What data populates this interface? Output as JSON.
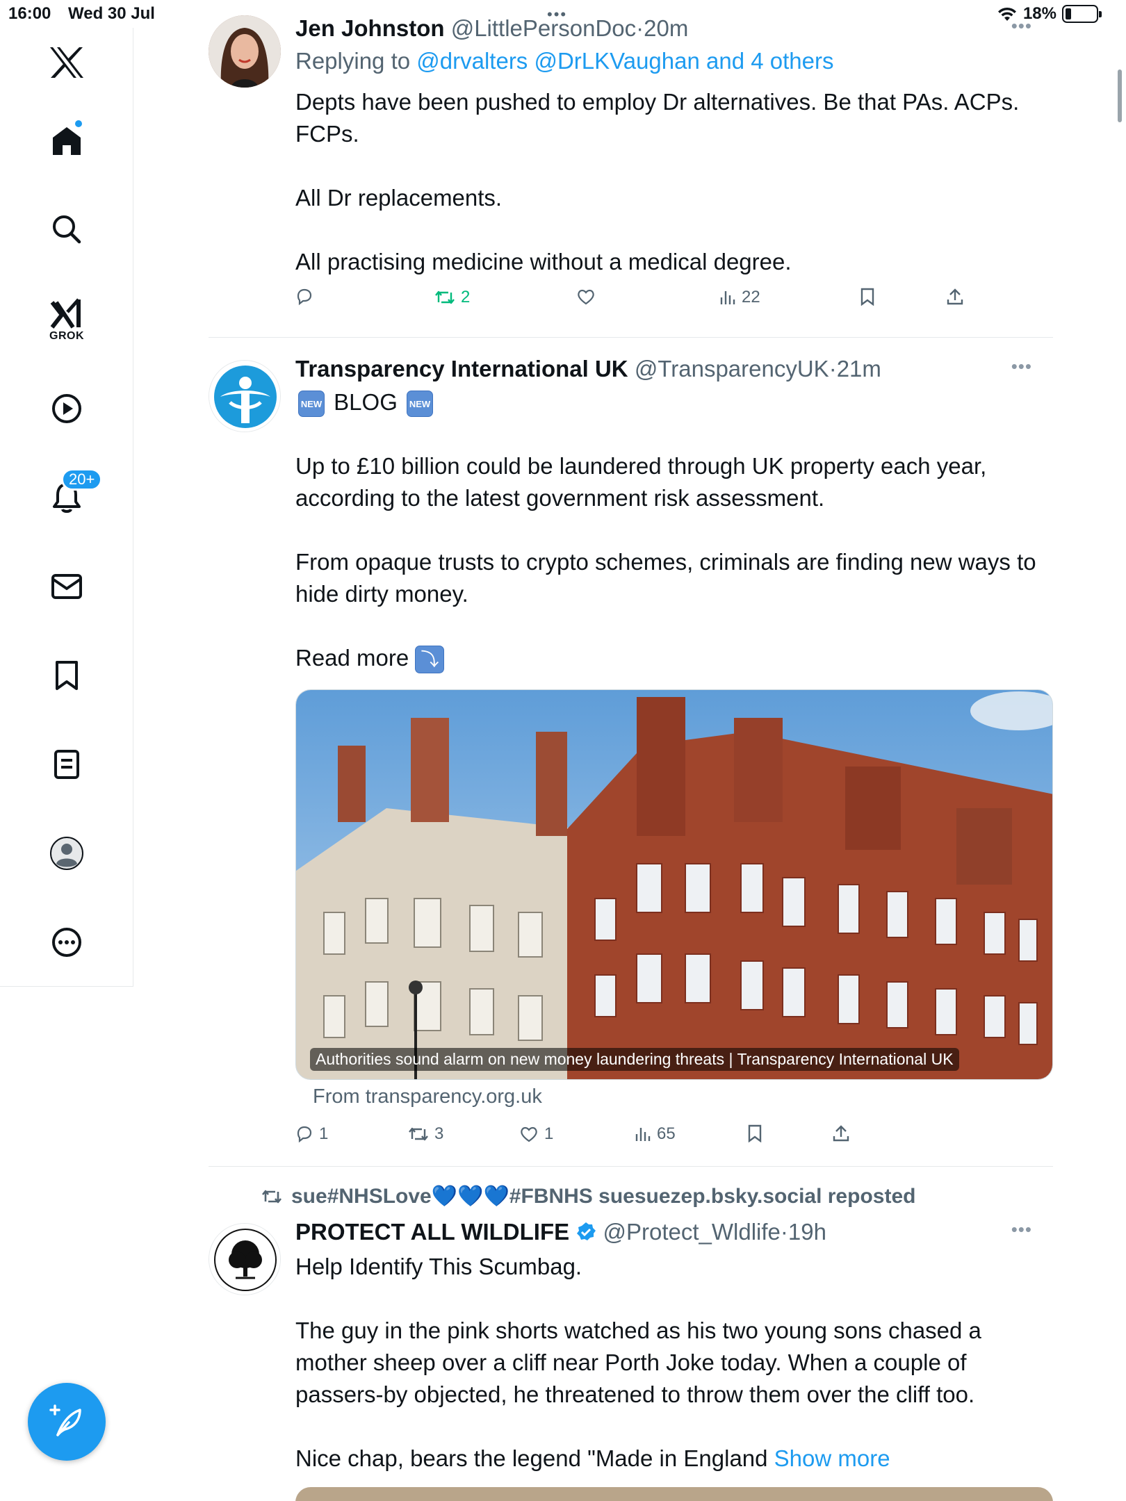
{
  "status_bar": {
    "time": "16:00",
    "date": "Wed 30 Jul",
    "battery": "18%",
    "battery_level": 0.18
  },
  "sidebar": {
    "items": [
      {
        "name": "x-logo",
        "label": "X"
      },
      {
        "name": "home",
        "label": "Home"
      },
      {
        "name": "explore",
        "label": "Search"
      },
      {
        "name": "grok",
        "label": "GROK"
      },
      {
        "name": "videos",
        "label": "Videos"
      },
      {
        "name": "notifications",
        "label": "Notifications",
        "badge": "20+"
      },
      {
        "name": "messages",
        "label": "Messages"
      },
      {
        "name": "bookmarks",
        "label": "Bookmarks"
      },
      {
        "name": "articles",
        "label": "Articles"
      },
      {
        "name": "profile",
        "label": "Profile"
      },
      {
        "name": "more",
        "label": "More"
      }
    ],
    "grok_label": "GROK",
    "notifications_badge": "20+"
  },
  "colors": {
    "accent": "#1d9bf0",
    "retweet_green": "#00ba7c",
    "muted": "#536471"
  },
  "tweets": [
    {
      "name": "Jen Johnston",
      "handle": "@LittlePersonDoc",
      "time": "20m",
      "separator": "·",
      "replying_prefix": "Replying to ",
      "replying_to": "@drvalters @DrLKVaughan and 4 others",
      "paragraphs": [
        "Depts have been pushed to employ Dr alternatives. Be that PAs. ACPs. FCPs.",
        "All Dr replacements.",
        "All practising medicine without a medical degree."
      ],
      "stats": {
        "replies": "",
        "reposts": "2",
        "likes": "",
        "views": "22"
      }
    },
    {
      "name": "Transparency International UK",
      "handle": "@TransparencyUK",
      "time": "21m",
      "separator": "·",
      "headline": "BLOG",
      "new_emoji_text": "NEW",
      "paragraphs": [
        "Up to £10 billion could be laundered through UK property each year, according to the latest government risk assessment.",
        "From opaque trusts to crypto schemes, criminals are finding new ways to hide dirty money.",
        "Read more"
      ],
      "arrow_emoji": "⤵",
      "card_caption": "Authorities sound alarm on new money laundering threats | Transparency International UK",
      "card_source": "From transparency.org.uk",
      "stats": {
        "replies": "1",
        "reposts": "3",
        "likes": "1",
        "views": "65"
      }
    },
    {
      "repost_by": "sue#NHSLove💙💙💙#FBNHS suesuezep.bsky.social reposted",
      "name": "PROTECT ALL WILDLIFE",
      "handle": "@Protect_Wldlife",
      "time": "19h",
      "separator": "·",
      "paragraphs": [
        "Help Identify This Scumbag.",
        "The guy in the pink shorts watched as his two young sons chased a mother sheep over a cliff near Porth Joke today. When a couple of passers-by objected, he threatened to throw them over the cliff too.",
        "Nice chap, bears the legend \"Made in England"
      ],
      "show_more": "Show more",
      "avatar_text": "PROTECT ALL WILDLIFE"
    }
  ]
}
